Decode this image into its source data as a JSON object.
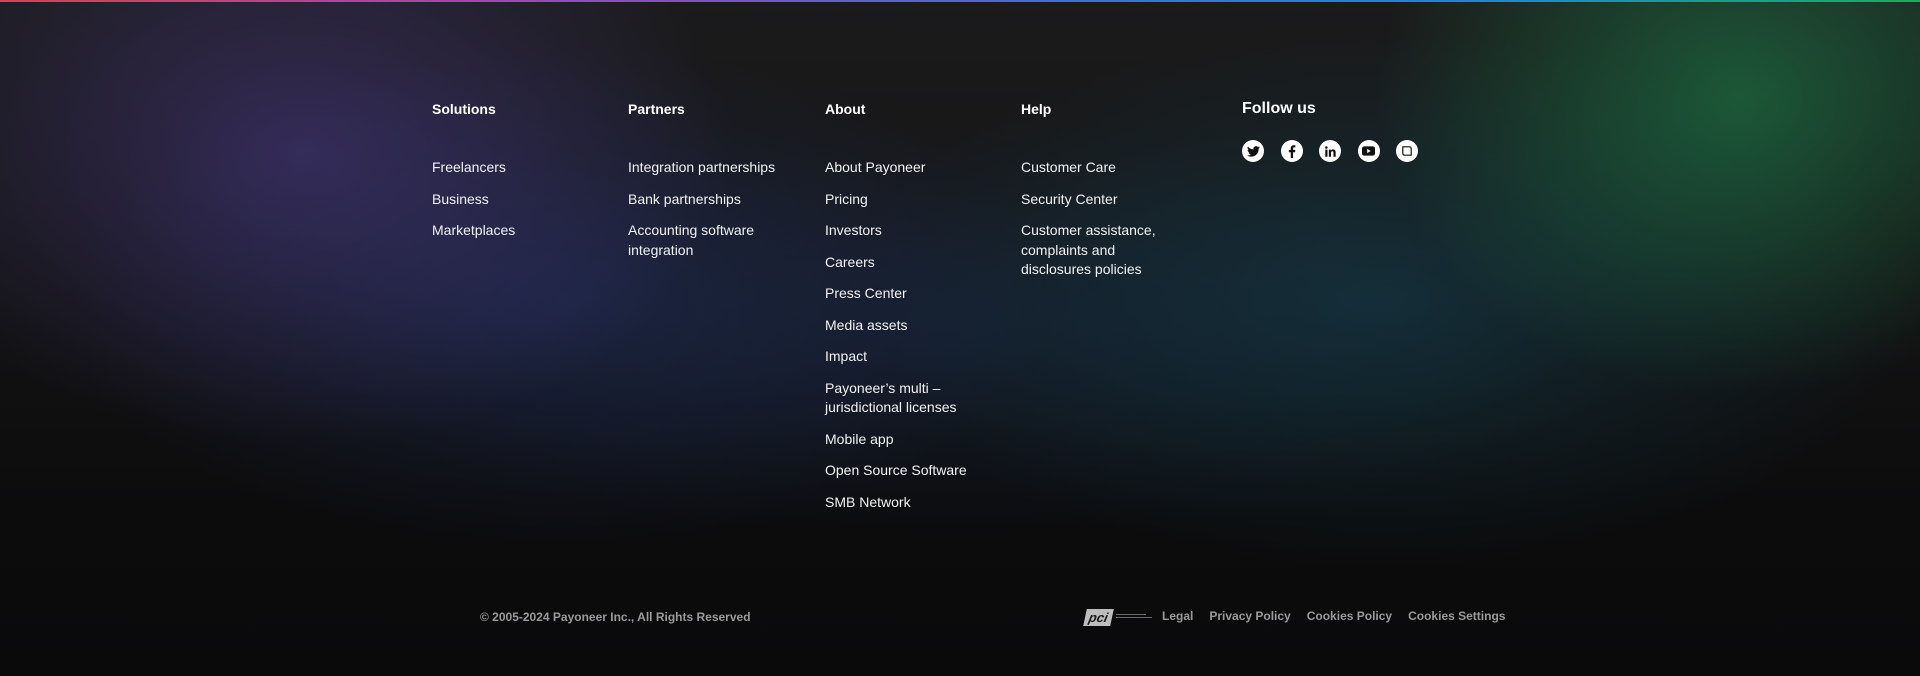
{
  "footer": {
    "columns": [
      {
        "heading": "Solutions",
        "links": [
          "Freelancers",
          "Business",
          "Marketplaces"
        ]
      },
      {
        "heading": "Partners",
        "links": [
          "Integration partnerships",
          "Bank partnerships",
          "Accounting software integration"
        ]
      },
      {
        "heading": "About",
        "links": [
          "About Payoneer",
          "Pricing",
          "Investors",
          "Careers",
          "Press Center",
          "Media assets",
          "Impact",
          "Payoneer’s multi – jurisdictional licenses",
          "Mobile app",
          "Open Source Software",
          "SMB Network"
        ]
      },
      {
        "heading": "Help",
        "links": [
          "Customer Care",
          "Security Center",
          "Customer assistance, complaints and disclosures policies"
        ]
      }
    ],
    "follow": {
      "heading": "Follow us",
      "icons": [
        "twitter-icon",
        "facebook-icon",
        "linkedin-icon",
        "youtube-icon",
        "blog-icon"
      ]
    },
    "copyright": "© 2005-2024 Payoneer Inc., All Rights Reserved",
    "pci": {
      "logo": "pci"
    },
    "legal": [
      "Legal",
      "Privacy Policy",
      "Cookies Policy",
      "Cookies Settings"
    ]
  },
  "colors": {
    "background": "#0d0d0e",
    "link_text": "#f2f2f2",
    "muted_text": "#9a9a9a"
  }
}
